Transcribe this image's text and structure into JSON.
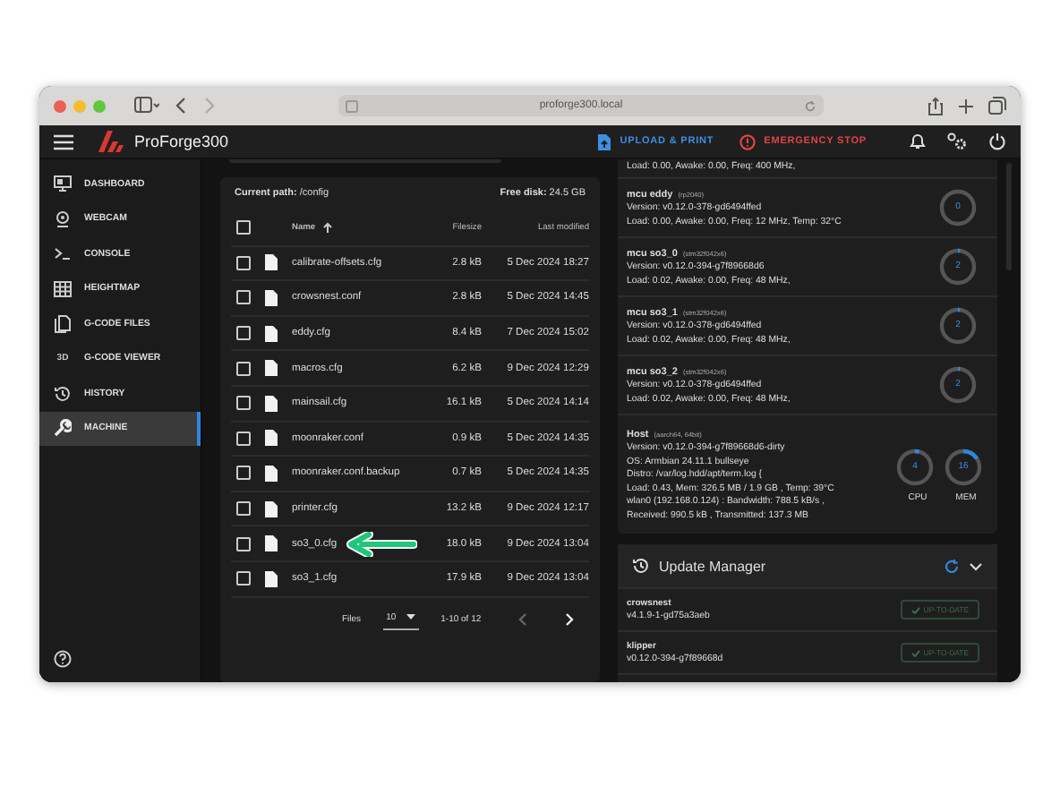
{
  "browser": {
    "url": "proforge300.local"
  },
  "app_bar": {
    "title": "ProForge300",
    "upload_button": "UPLOAD & PRINT",
    "emergency_button": "EMERGENCY STOP"
  },
  "sidebar": {
    "items": [
      {
        "label": "DASHBOARD",
        "kind": "monitor",
        "selected": false
      },
      {
        "label": "WEBCAM",
        "kind": "webcam",
        "selected": false
      },
      {
        "label": "CONSOLE",
        "kind": "console",
        "selected": false
      },
      {
        "label": "HEIGHTMAP",
        "kind": "grid",
        "selected": false
      },
      {
        "label": "G-CODE FILES",
        "kind": "files",
        "selected": false
      },
      {
        "label": "G-CODE VIEWER",
        "kind": "text",
        "icon_text": "3D",
        "selected": false
      },
      {
        "label": "HISTORY",
        "kind": "history",
        "selected": false
      },
      {
        "label": "MACHINE",
        "kind": "wrench",
        "selected": true
      }
    ]
  },
  "files": {
    "current_path_label": "Current path:",
    "current_path": "/config",
    "free_disk_label": "Free disk:",
    "free_disk": "24.5 GB",
    "select_all_checked": false,
    "columns": [
      "Name",
      "Filesize",
      "Last modified"
    ],
    "rows": [
      {
        "name": "calibrate-offsets.cfg",
        "size": "2.8 kB",
        "modified": "5 Dec 2024 18:27",
        "checked": false
      },
      {
        "name": "crowsnest.conf",
        "size": "2.8 kB",
        "modified": "5 Dec 2024 14:45",
        "checked": false
      },
      {
        "name": "eddy.cfg",
        "size": "8.4 kB",
        "modified": "7 Dec 2024 15:02",
        "checked": false
      },
      {
        "name": "macros.cfg",
        "size": "6.2 kB",
        "modified": "9 Dec 2024 12:29",
        "checked": false
      },
      {
        "name": "mainsail.cfg",
        "size": "16.1 kB",
        "modified": "5 Dec 2024 14:14",
        "checked": false
      },
      {
        "name": "moonraker.conf",
        "size": "0.9 kB",
        "modified": "5 Dec 2024 14:35",
        "checked": false
      },
      {
        "name": "moonraker.conf.backup",
        "size": "0.7 kB",
        "modified": "5 Dec 2024 14:35",
        "checked": false
      },
      {
        "name": "printer.cfg",
        "size": "13.2 kB",
        "modified": "9 Dec 2024 12:17",
        "checked": false
      },
      {
        "name": "so3_0.cfg",
        "size": "18.0 kB",
        "modified": "9 Dec 2024 13:04",
        "checked": false,
        "highlighted": true
      },
      {
        "name": "so3_1.cfg",
        "size": "17.9 kB",
        "modified": "9 Dec 2024 13:04",
        "checked": false
      }
    ],
    "footer": {
      "label": "Files",
      "per_page": "10",
      "range": "1-10 of 12",
      "prev_disabled": true,
      "next_disabled": false
    }
  },
  "mcus": {
    "top_line": "Load: 0.00, Awake: 0.00, Freq: 400 MHz,",
    "items": [
      {
        "name": "mcu eddy",
        "chip": "(rp2040)",
        "lines": [
          "Version: v0.12.0-378-gd6494ffed",
          "Load: 0.00, Awake: 0.00, Freq: 12 MHz, Temp: 32°C"
        ],
        "gauge": "0"
      },
      {
        "name": "mcu so3_0",
        "chip": "(stm32f042x6)",
        "lines": [
          "Version: v0.12.0-394-g7f89668d6",
          "Load: 0.02, Awake: 0.00, Freq: 48 MHz,"
        ],
        "gauge": "2"
      },
      {
        "name": "mcu so3_1",
        "chip": "(stm32f042x6)",
        "lines": [
          "Version: v0.12.0-378-gd6494ffed",
          "Load: 0.02, Awake: 0.00, Freq: 48 MHz,"
        ],
        "gauge": "2"
      },
      {
        "name": "mcu so3_2",
        "chip": "(stm32f042x6)",
        "lines": [
          "Version: v0.12.0-378-gd6494ffed",
          "Load: 0.02, Awake: 0.00, Freq: 48 MHz,"
        ],
        "gauge": "2"
      }
    ],
    "host": {
      "name": "Host",
      "chip": "(aarch64, 64bit)",
      "lines": [
        "Version: v0.12.0-394-g7f89668d6-dirty",
        "OS: Armbian 24.11.1 bullseye",
        "Distro: /var/log.hdd/apt/term.log {",
        "Load: 0.43, Mem: 326.5 MB / 1.9 GB , Temp: 39°C",
        "wlan0 (192.168.0.124) : Bandwidth: 788.5 kB/s ,",
        "Received: 990.5 kB , Transmitted: 137.3 MB"
      ],
      "gauges": [
        {
          "value": "4",
          "label": "CPU"
        },
        {
          "value": "16",
          "label": "MEM"
        }
      ]
    }
  },
  "update_manager": {
    "title": "Update Manager",
    "items": [
      {
        "name": "crowsnest",
        "version": "v4.1.9-1-gd75a3aeb",
        "status": "UP-TO-DATE"
      },
      {
        "name": "klipper",
        "version": "v0.12.0-394-g7f89668d",
        "status": "UP-TO-DATE"
      }
    ]
  }
}
